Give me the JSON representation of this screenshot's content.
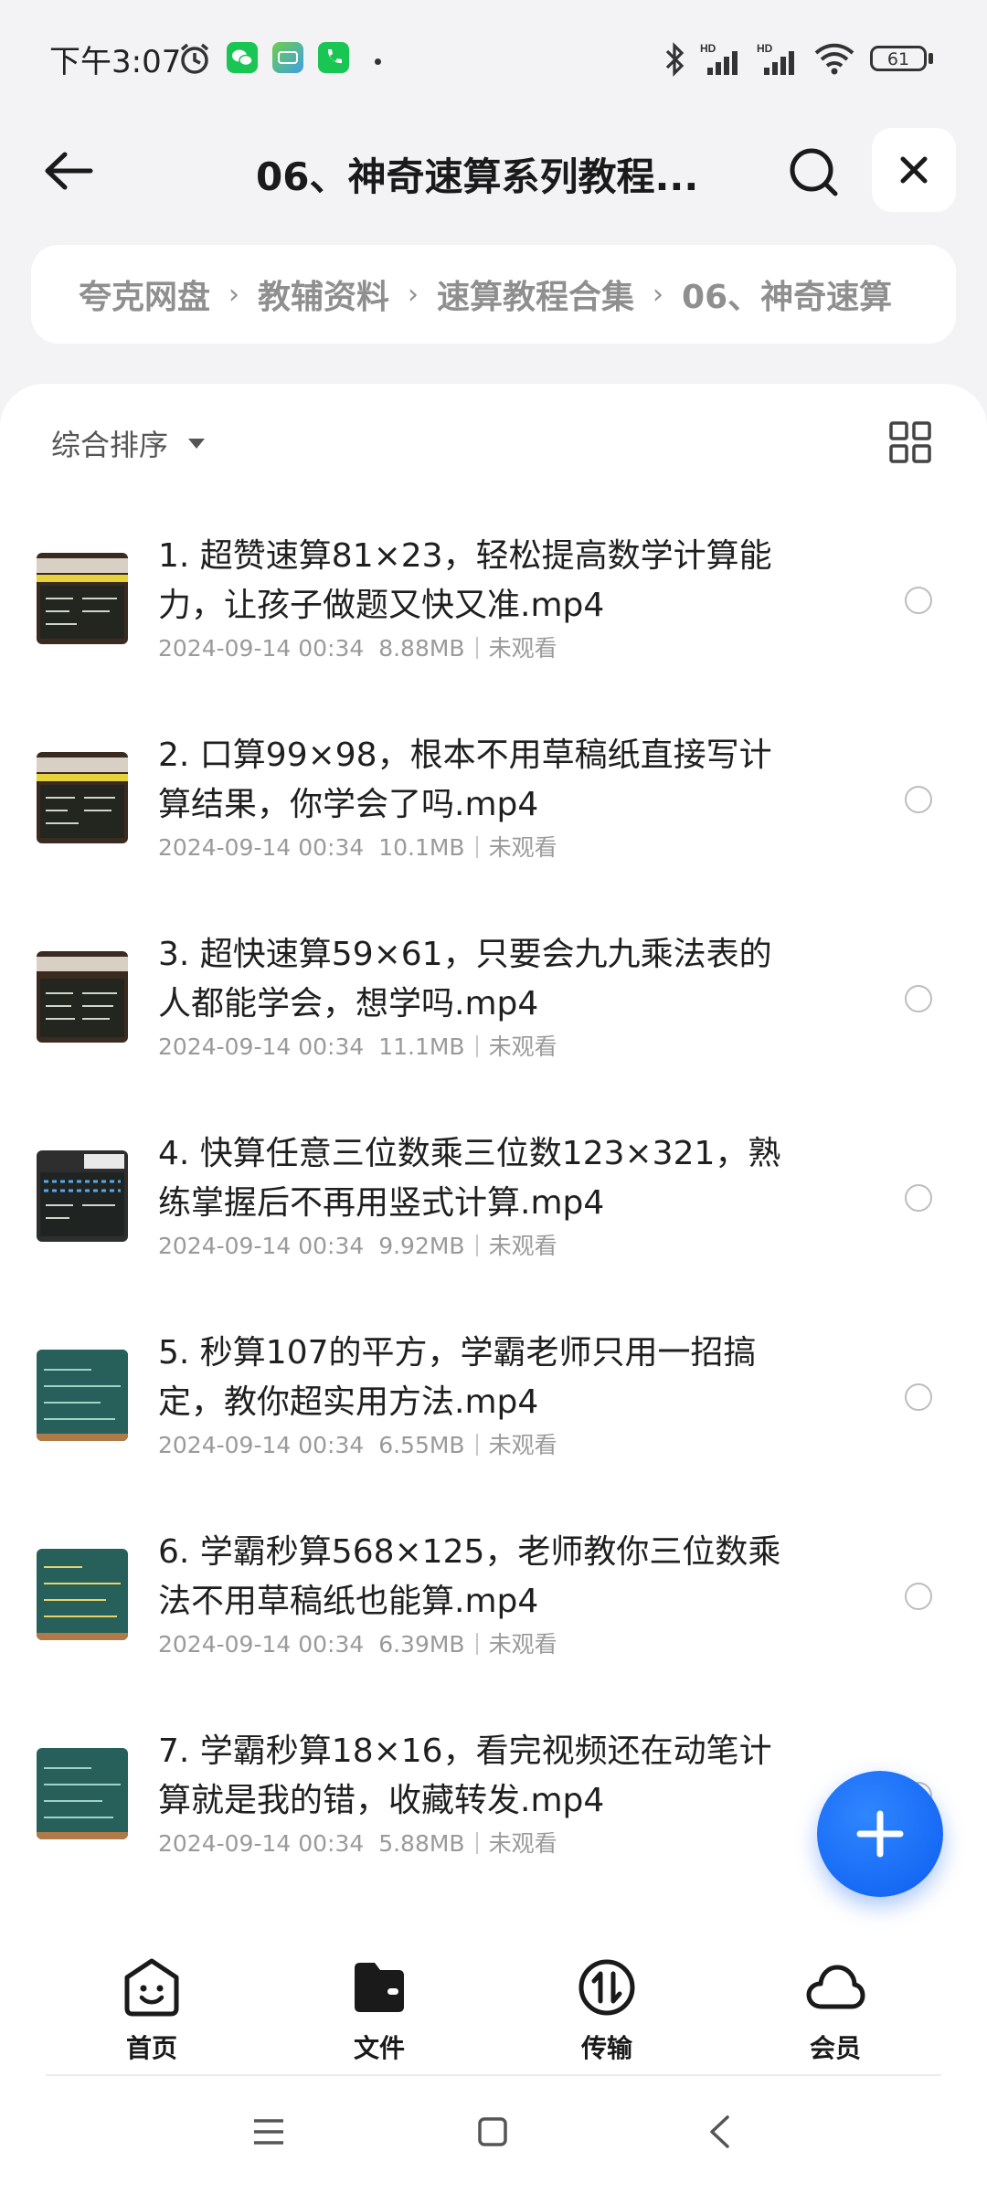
{
  "status_bar": {
    "time": "下午3:07",
    "battery": "61",
    "icons": [
      "alarm-icon",
      "wechat-icon",
      "iqiyi-icon",
      "phone-icon",
      "bluetooth-icon",
      "signal-hd-icon",
      "signal-hd-icon",
      "wifi-icon",
      "battery-icon"
    ]
  },
  "header": {
    "title": "06、神奇速算系列教程...",
    "back_icon": "arrow-left-icon",
    "search_icon": "search-icon",
    "close_icon": "close-icon"
  },
  "breadcrumb": {
    "items": [
      "夸克网盘",
      "教辅资料",
      "速算教程合集",
      "06、神奇速算"
    ],
    "separator": "›"
  },
  "toolbar": {
    "sort_label": "综合排序",
    "view_toggle_icon": "grid-view-icon"
  },
  "files": [
    {
      "name": "1. 超赞速算81×23，轻松提高数学计算能力，让孩子做题又快又准.mp4",
      "date": "2024-09-14 00:34",
      "size": "8.88MB",
      "status": "未观看",
      "thumb": "blackboard-red"
    },
    {
      "name": "2. 口算99×98，根本不用草稿纸直接写计算结果，你学会了吗.mp4",
      "date": "2024-09-14 00:34",
      "size": "10.1MB",
      "status": "未观看",
      "thumb": "blackboard-red"
    },
    {
      "name": "3. 超快速算59×61，只要会九九乘法表的人都能学会，想学吗.mp4",
      "date": "2024-09-14 00:34",
      "size": "11.1MB",
      "status": "未观看",
      "thumb": "blackboard-red"
    },
    {
      "name": "4. 快算任意三位数乘三位数123×321，熟练掌握后不再用竖式计算.mp4",
      "date": "2024-09-14 00:34",
      "size": "9.92MB",
      "status": "未观看",
      "thumb": "blackboard-grey"
    },
    {
      "name": "5. 秒算107的平方，学霸老师只用一招搞定，教你超实用方法.mp4",
      "date": "2024-09-14 00:34",
      "size": "6.55MB",
      "status": "未观看",
      "thumb": "blackboard-green"
    },
    {
      "name": "6. 学霸秒算568×125，老师教你三位数乘法不用草稿纸也能算.mp4",
      "date": "2024-09-14 00:34",
      "size": "6.39MB",
      "status": "未观看",
      "thumb": "blackboard-green"
    },
    {
      "name": "7. 学霸秒算18×16，看完视频还在动笔计算就是我的错，收藏转发.mp4",
      "date": "2024-09-14 00:34",
      "size": "5.88MB",
      "status": "未观看",
      "thumb": "blackboard-green"
    }
  ],
  "fab": {
    "icon": "plus-icon"
  },
  "bottom_nav": [
    {
      "label": "首页",
      "icon": "home-smile-icon"
    },
    {
      "label": "文件",
      "icon": "folder-icon"
    },
    {
      "label": "传输",
      "icon": "transfer-icon"
    },
    {
      "label": "会员",
      "icon": "cloud-icon"
    }
  ],
  "system_nav": {
    "icons": [
      "menu-icon",
      "home-square-icon",
      "back-chevron-icon"
    ]
  },
  "colors": {
    "accent": "#0d5ef0",
    "text": "#1f1f1f",
    "meta": "#9a9a9a",
    "background": "#f3f3f5"
  }
}
